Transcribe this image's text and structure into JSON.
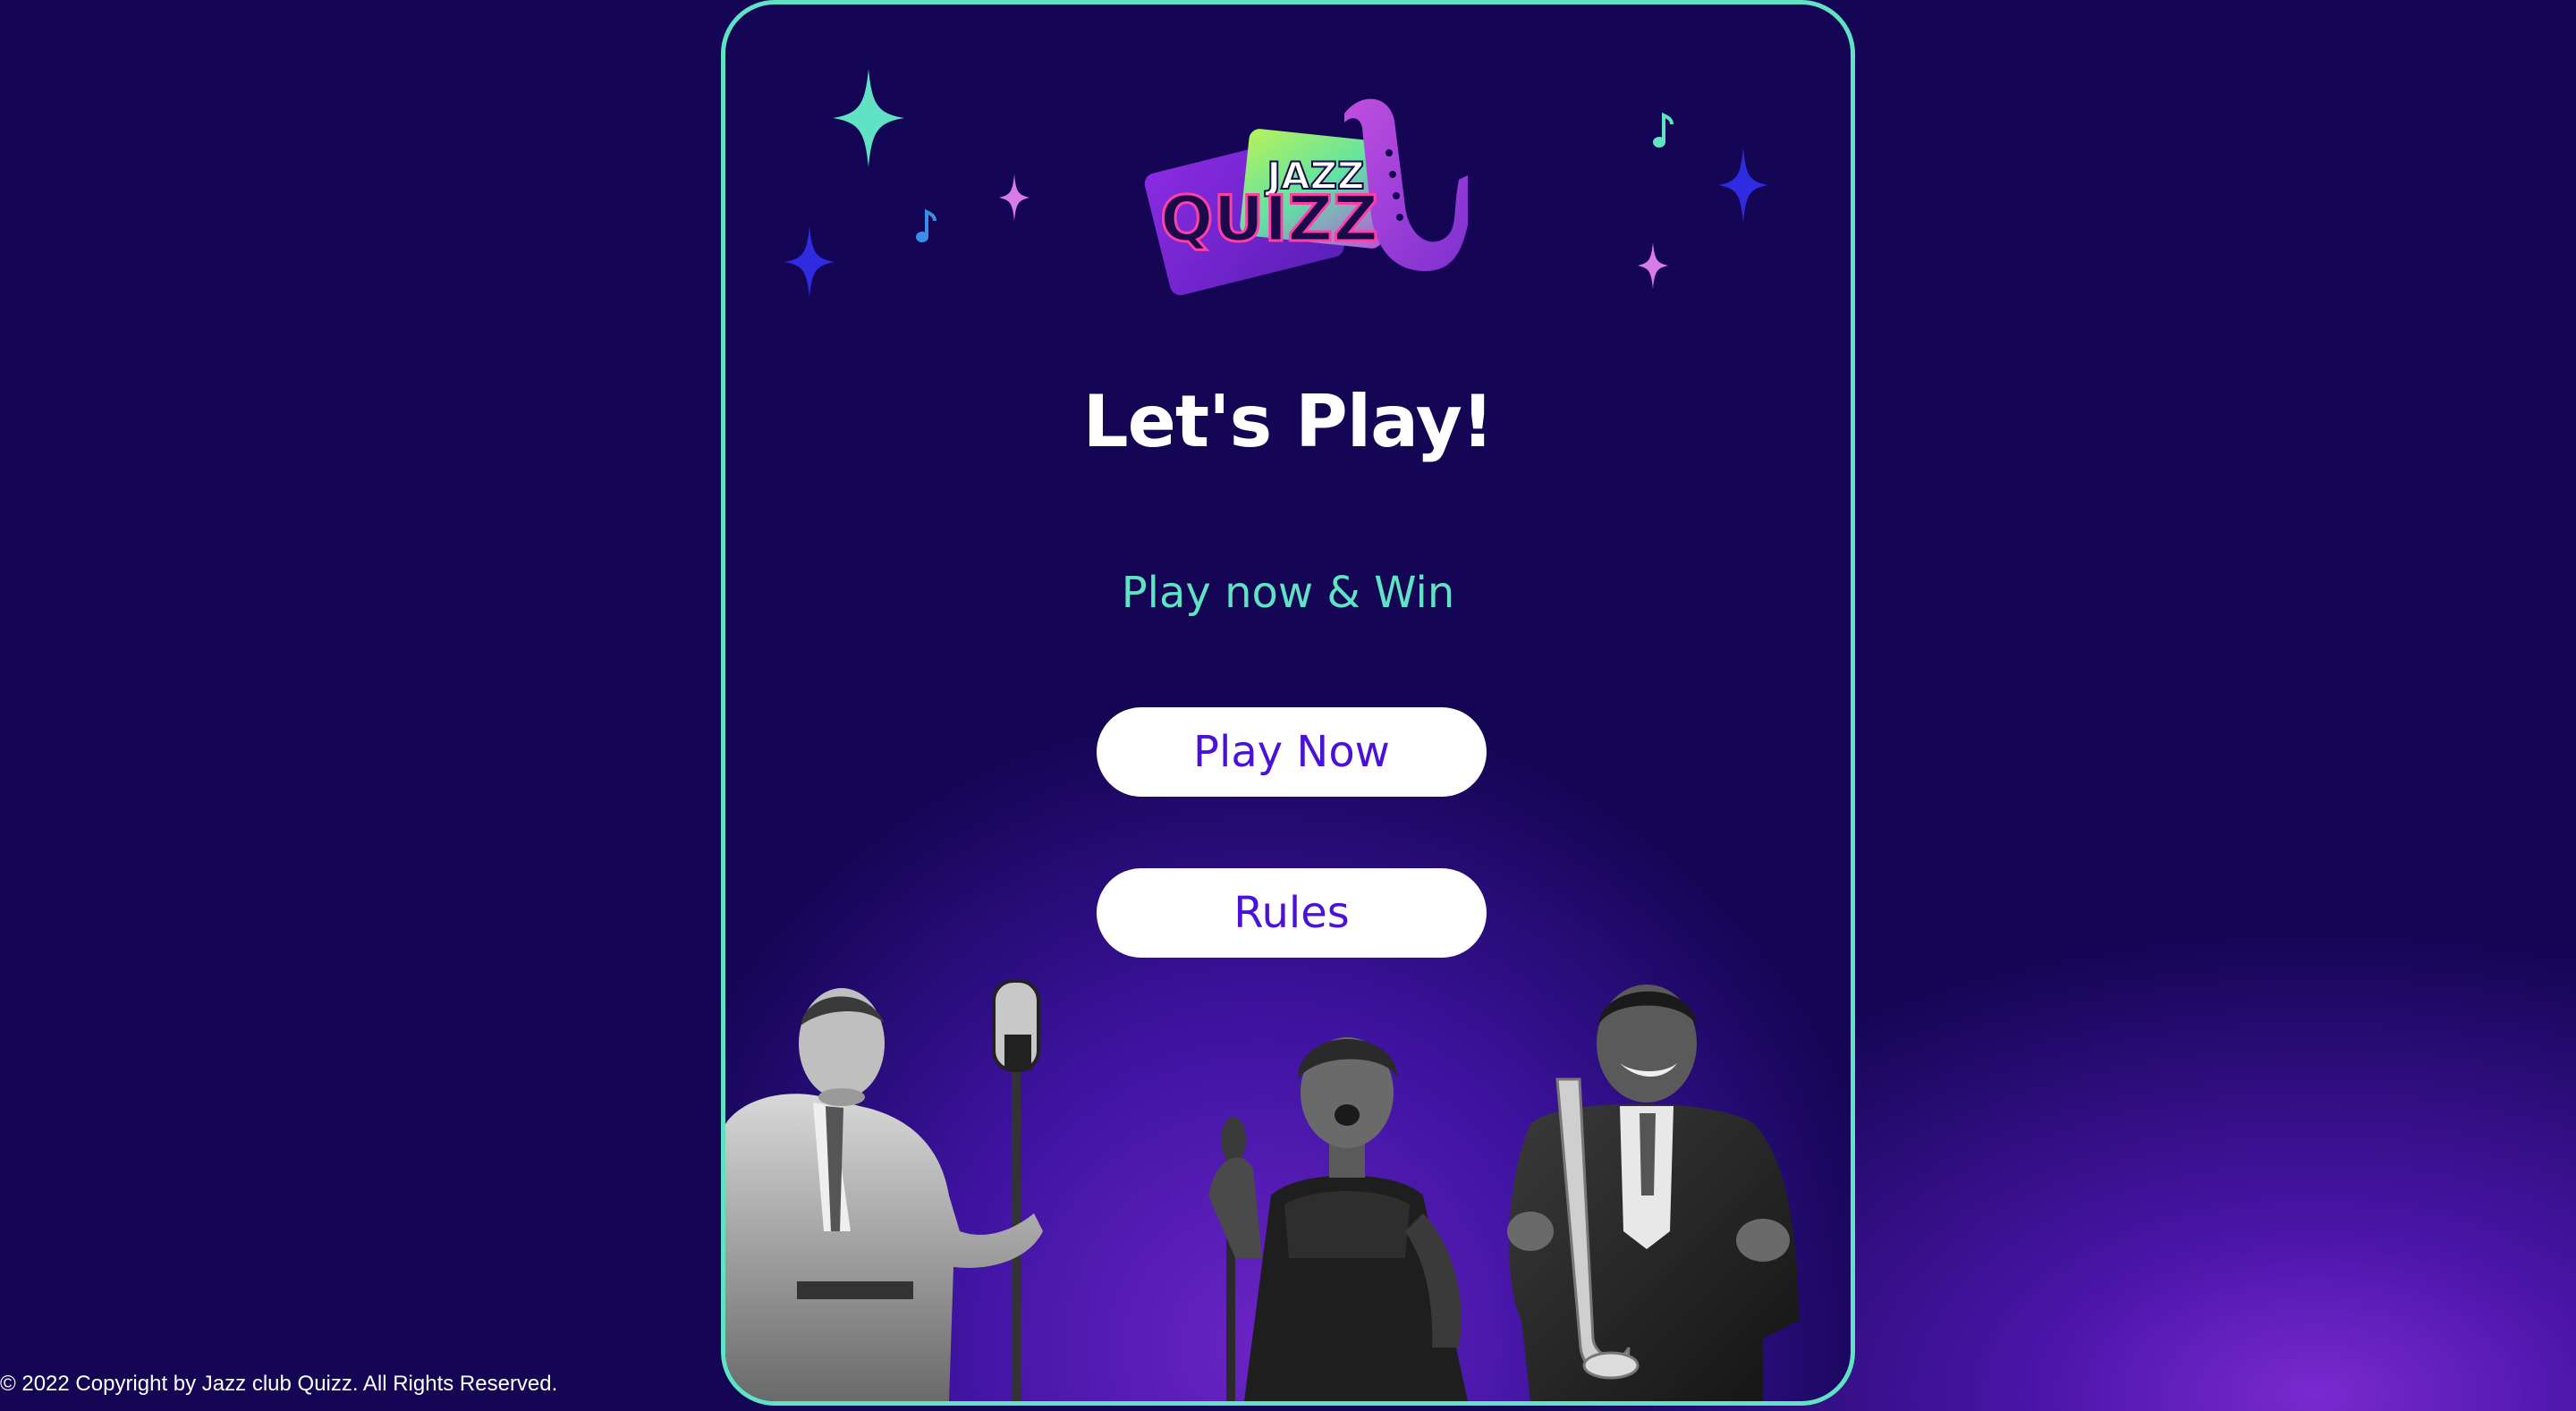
{
  "logo": {
    "line1": "JAZZ",
    "line2": "QUIZZ",
    "icon": "saxophone-icon"
  },
  "main": {
    "heading": "Let's Play!",
    "subheading": "Play now & Win",
    "play_button": "Play Now",
    "rules_button": "Rules"
  },
  "footer": {
    "copyright": "© 2022 Copyright by Jazz club Quizz. All Rights Reserved."
  },
  "decor": {
    "sparkle_icon": "sparkle-icon",
    "note_icon": "music-note-icon",
    "note_glyph": "♪"
  },
  "colors": {
    "background": "#140654",
    "card_border": "#5fe3c4",
    "accent_teal": "#5fe3c4",
    "button_bg": "#ffffff",
    "button_text": "#4a12d6",
    "sparkle_blue": "#2f2be0",
    "sparkle_pink": "#d77be8",
    "logo_purple": "#9b3fe0",
    "logo_pink": "#ff3fa6",
    "logo_green": "#5fe3a4"
  }
}
